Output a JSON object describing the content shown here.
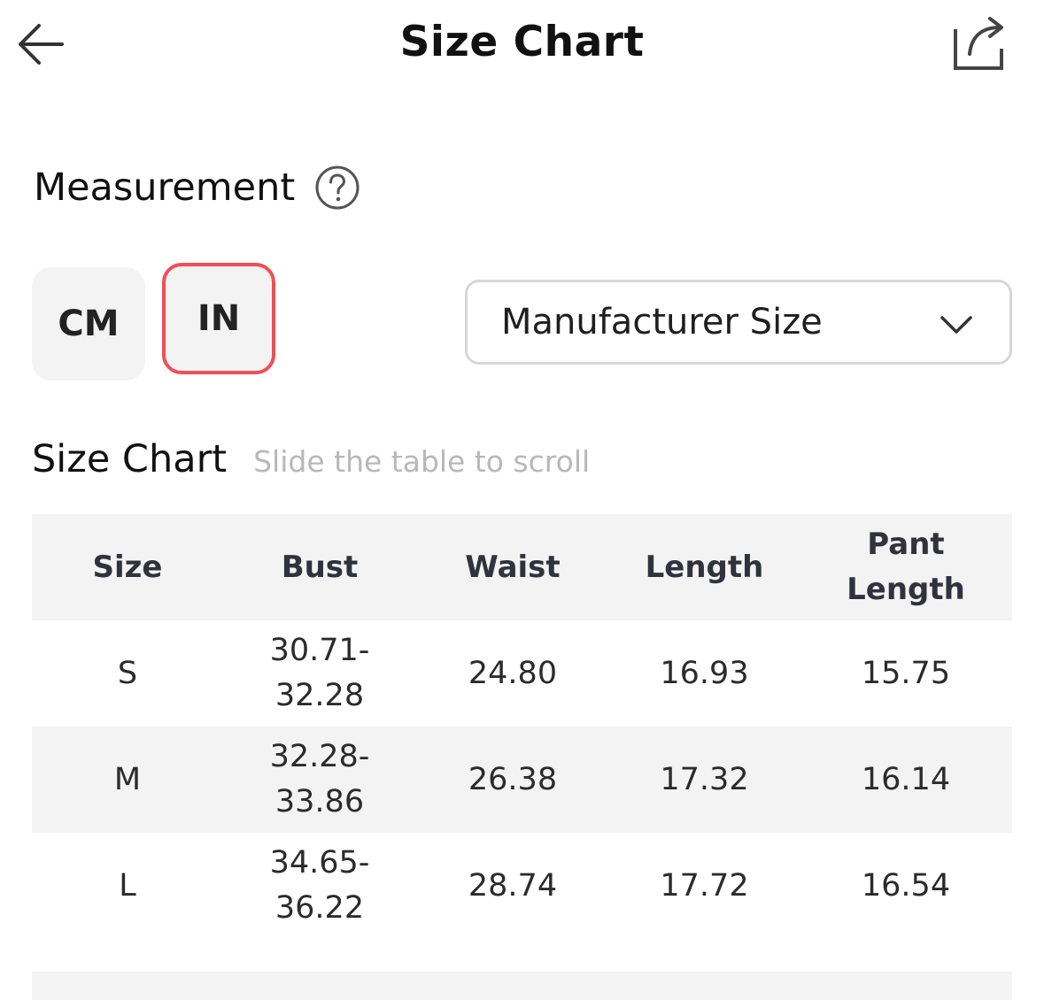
{
  "header": {
    "title": "Size Chart",
    "back_icon": "arrow-left-icon",
    "share_icon": "share-icon"
  },
  "measurement": {
    "title": "Measurement",
    "help_icon": "question-circle-icon",
    "units": [
      "CM",
      "IN"
    ],
    "selected_unit": "IN",
    "selected_unit_color": "#f34d55"
  },
  "size_select": {
    "value": "Manufacturer Size",
    "icon": "chevron-down-icon"
  },
  "size_chart": {
    "title": "Size Chart",
    "hint": "Slide the table to scroll",
    "headers": [
      "Size",
      "Bust",
      "Waist",
      "Length",
      "Pant\nLength"
    ],
    "rows": [
      [
        "S",
        "30.71-\n32.28",
        "24.80",
        "16.93",
        "15.75"
      ],
      [
        "M",
        "32.28-\n33.86",
        "26.38",
        "17.32",
        "16.14"
      ],
      [
        "L",
        "34.65-\n36.22",
        "28.74",
        "17.72",
        "16.54"
      ]
    ]
  }
}
